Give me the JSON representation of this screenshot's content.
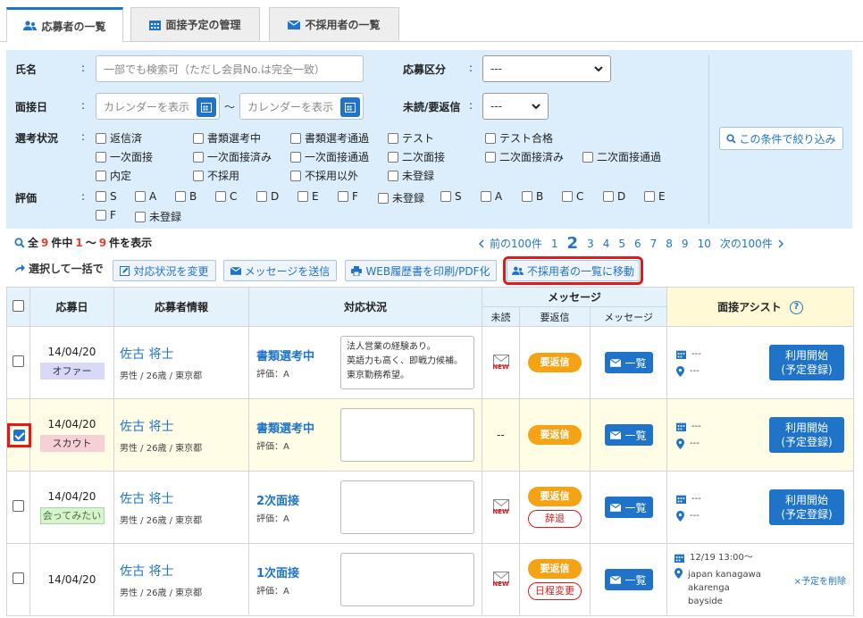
{
  "tabs": [
    {
      "label": "応募者の一覧",
      "icon": "users-icon",
      "active": true
    },
    {
      "label": "面接予定の管理",
      "icon": "calendar-icon",
      "active": false
    },
    {
      "label": "不採用者の一覧",
      "icon": "mail-icon",
      "active": false
    }
  ],
  "filter": {
    "name_label": "氏名",
    "name_placeholder": "一部でも検索可（ただし会員No.は完全一致）",
    "category_label": "応募区分",
    "category_value": "---",
    "interview_label": "面接日",
    "date_from_placeholder": "カレンダーを表示",
    "date_to_placeholder": "カレンダーを表示",
    "range_sep": "〜",
    "unread_label": "未読/要返信",
    "unread_value": "---",
    "status_label": "選考状況",
    "status_options": [
      "返信済",
      "書類選考中",
      "書類選考通過",
      "テスト",
      "テスト合格",
      "一次面接",
      "一次面接済み",
      "一次面接通過",
      "二次面接",
      "二次面接済み",
      "二次面接通過",
      "内定",
      "不採用",
      "不採用以外",
      "未登録"
    ],
    "rating_label": "評価",
    "rating_options": [
      "S",
      "A",
      "B",
      "C",
      "D",
      "E",
      "F",
      "未登録",
      "S",
      "A",
      "B",
      "C",
      "D",
      "E",
      "F",
      "未登録"
    ],
    "colon": ":",
    "narrow_button": "この条件で絞り込み"
  },
  "results": {
    "prefix": "全",
    "total": "9",
    "mid": "件中",
    "from": "1",
    "tilde": "〜",
    "to": "9",
    "suffix": "件を表示"
  },
  "pager": {
    "prev": "前の100件",
    "pages": [
      "1",
      "2",
      "3",
      "4",
      "5",
      "6",
      "7",
      "8",
      "9",
      "10"
    ],
    "current": "2",
    "next": "次の100件"
  },
  "bulk": {
    "label": "選択して一括で",
    "buttons": [
      "対応状況を変更",
      "メッセージを送信",
      "WEB履歴書を印刷/PDF化",
      "不採用者の一覧に移動"
    ]
  },
  "table": {
    "headers": {
      "date": "応募日",
      "info": "応募者情報",
      "status": "対応状況",
      "message": "メッセージ",
      "unread": "未読",
      "reply": "要返信",
      "msg": "メッセージ",
      "assist": "面接アシスト",
      "help": "?"
    },
    "rows": [
      {
        "date": "14/04/20",
        "tag": "オファー",
        "tag_type": "offer",
        "name": "佐古 将士",
        "meta": "男性 / 26歳 / 東京都",
        "status": "書類選考中",
        "eval": "評価：A",
        "memo": "法人営業の経験あり。\n英語力も高く、即戦力候補。\n東京勤務希望。",
        "unread": "new",
        "reply": "要返信",
        "secondary": "",
        "list": "一覧",
        "a1": "---",
        "a2": "---",
        "start": "利用開始\n(予定登録)",
        "checked": false
      },
      {
        "date": "14/04/20",
        "tag": "スカウト",
        "tag_type": "scout",
        "name": "佐古 将士",
        "meta": "男性 / 26歳 / 東京都",
        "status": "書類選考中",
        "eval": "評価：A",
        "memo": "",
        "unread": "--",
        "reply": "要返信",
        "secondary": "",
        "list": "一覧",
        "a1": "---",
        "a2": "---",
        "start": "利用開始\n(予定登録)",
        "checked": true
      },
      {
        "date": "14/04/20",
        "tag": "会ってみたい",
        "tag_type": "meet",
        "name": "佐古 将士",
        "meta": "男性 / 26歳 / 東京都",
        "status": "2次面接",
        "eval": "評価：A",
        "memo": "",
        "unread": "new",
        "reply": "要返信",
        "secondary": "辞退",
        "list": "一覧",
        "a1": "---",
        "a2": "---",
        "start": "利用開始\n(予定登録)",
        "checked": false
      },
      {
        "date": "14/04/20",
        "tag": "",
        "tag_type": "",
        "name": "佐古 将士",
        "meta": "男性 / 26歳 / 東京都",
        "status": "1次面接",
        "eval": "評価：A",
        "memo": "",
        "unread": "new",
        "reply": "要返信",
        "secondary": "日程変更",
        "list": "一覧",
        "a1": "12/19 13:00〜",
        "a2": "japan kanagawa\nakarenga\nbayside",
        "delete": "×予定を削除",
        "checked": false
      }
    ]
  },
  "colors": {
    "accent": "#1f74c9",
    "reply": "#f5a314",
    "highlight": "#e2191b",
    "filter_bg": "#dceefb"
  }
}
